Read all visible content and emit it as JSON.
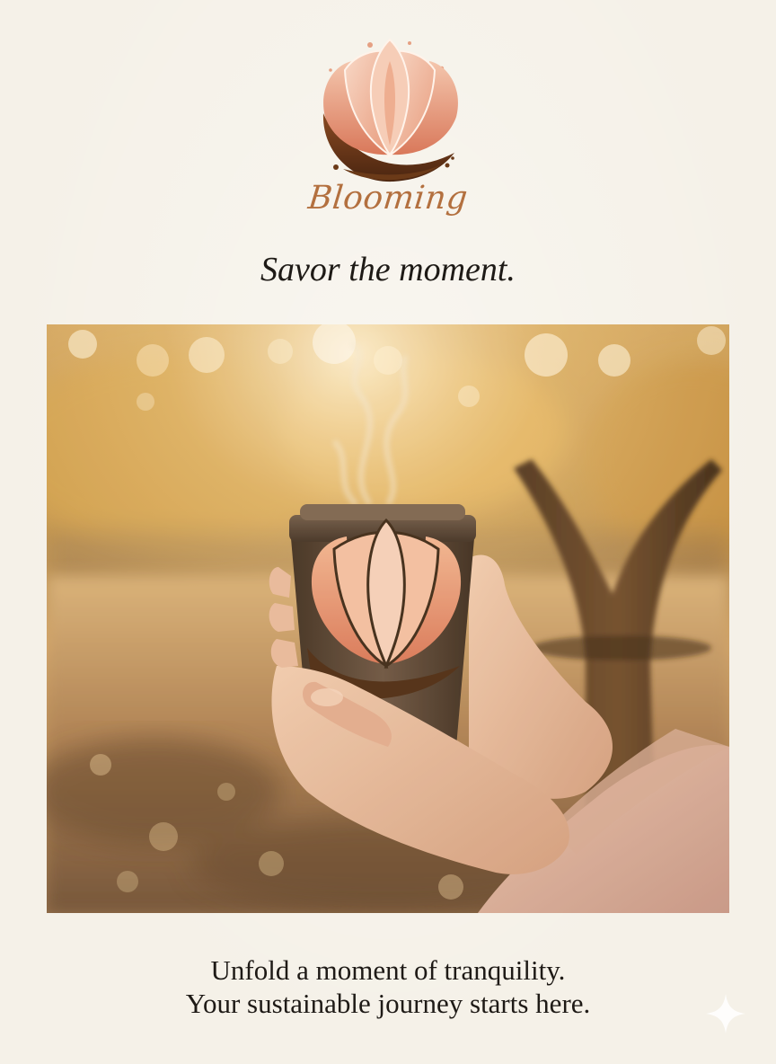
{
  "brand": {
    "name": "Blooming",
    "logo_icon": "lotus-coffee-cup-icon",
    "color": "#b3703f"
  },
  "hero": {
    "tagline": "Savor the moment.",
    "image_subject": "hands-holding-blooming-coffee-cup-photo"
  },
  "footer": {
    "line1": "Unfold a moment of tranquility.",
    "line2": "Your sustainable journey starts here."
  },
  "decor": {
    "corner_icon": "sparkle-icon"
  },
  "colors": {
    "background": "#f5f1e8",
    "text": "#1e1a16",
    "petal": "#e8a383",
    "cup": "#5b4636"
  }
}
